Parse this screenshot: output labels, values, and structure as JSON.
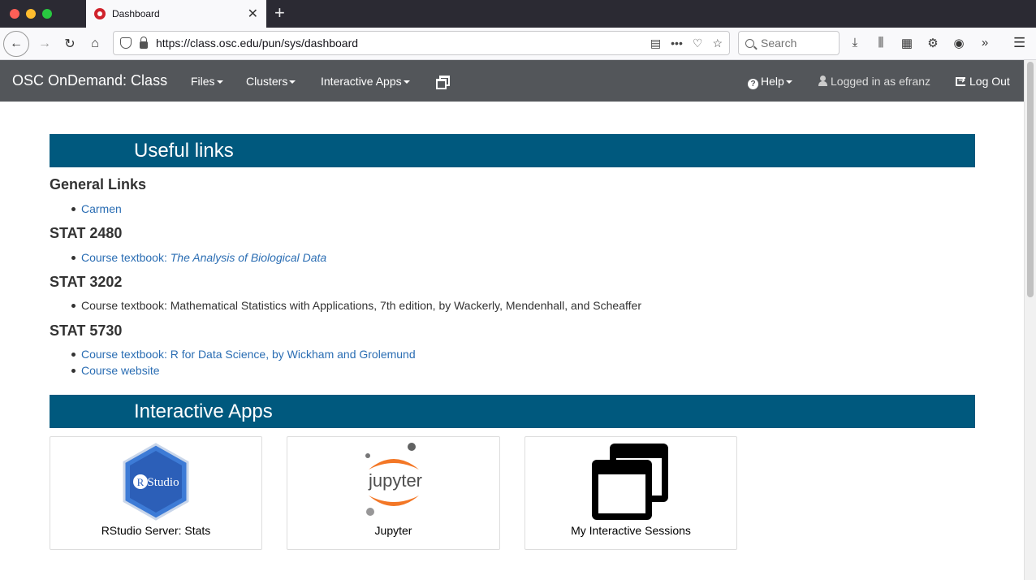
{
  "browser": {
    "tab_title": "Dashboard",
    "tab_close": "✕",
    "new_tab": "+",
    "url": "https://class.osc.edu/pun/sys/dashboard",
    "search_placeholder": "Search",
    "url_icons": [
      "reader-view-icon",
      "more-actions-icon",
      "pocket-icon",
      "bookmark-star-icon"
    ],
    "toolbar_icons": [
      "download-icon",
      "library-icon",
      "extensions-icon",
      "settings-gear-icon",
      "account-icon",
      "overflow-icon"
    ]
  },
  "appnav": {
    "brand": "OSC OnDemand: Class",
    "files": "Files",
    "clusters": "Clusters",
    "interactive_apps": "Interactive Apps",
    "help": "Help",
    "logged_in": "Logged in as efranz",
    "logout": "Log Out"
  },
  "useful_links": {
    "title": "Useful links",
    "general": {
      "heading": "General Links",
      "items": [
        "Carmen"
      ]
    },
    "stat2480": {
      "heading": "STAT 2480",
      "item_prefix": "Course textbook: ",
      "item_title": "The Analysis of Biological Data"
    },
    "stat3202": {
      "heading": "STAT 3202",
      "item": "Course textbook: Mathematical Statistics with Applications, 7th edition, by Wackerly, Mendenhall, and Scheaffer"
    },
    "stat5730": {
      "heading": "STAT 5730",
      "items": [
        "Course textbook: R for Data Science, by Wickham and Grolemund",
        "Course website"
      ]
    }
  },
  "interactive_apps": {
    "title": "Interactive Apps",
    "apps": [
      {
        "label": "RStudio Server: Stats",
        "logo_text": "Studio",
        "logo_letter": "R"
      },
      {
        "label": "Jupyter",
        "logo_text": "jupyter"
      },
      {
        "label": "My Interactive Sessions"
      }
    ]
  },
  "colors": {
    "navbar": "#53565a",
    "section_bar": "#00597e",
    "link": "#2a6db3"
  }
}
